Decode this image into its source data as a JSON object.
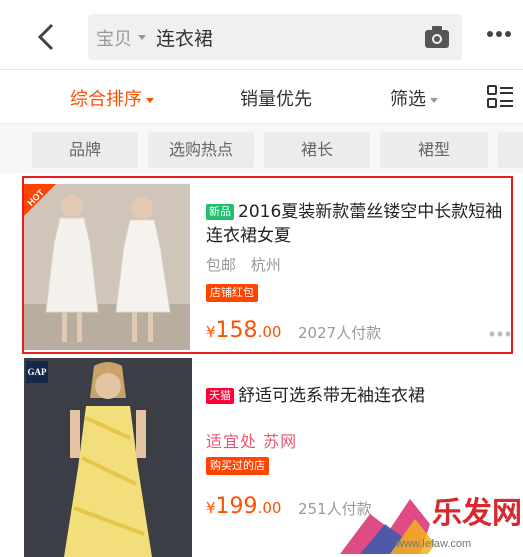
{
  "search": {
    "scope": "宝贝",
    "query": "连衣裙"
  },
  "sort": {
    "items": [
      {
        "label": "综合排序",
        "active": true
      },
      {
        "label": "销量优先",
        "active": false
      },
      {
        "label": "筛选",
        "active": false
      }
    ]
  },
  "filters": [
    "品牌",
    "选购热点",
    "裙长",
    "裙型"
  ],
  "products": [
    {
      "hot_badge": "HOT",
      "tag": "新品",
      "title": "2016夏装新款蕾丝镂空中长款短袖连衣裙女夏",
      "shipping": "包邮",
      "location": "杭州",
      "promo": "店铺红包",
      "price_symbol": "¥",
      "price_int": "158",
      "price_dec": ".00",
      "buyers": "2027人付款"
    },
    {
      "brand_logo": "GAP",
      "tag": "天猫",
      "title": "舒适可选系带无袖连衣裙",
      "shop": "适宜处 苏网",
      "promo": "购买过的店",
      "price_symbol": "¥",
      "price_int": "199",
      "price_dec": ".00",
      "buyers": "251人付款"
    }
  ],
  "watermark": {
    "text": "乐发网",
    "url": "www.lefaw.com"
  },
  "colors": {
    "accent": "#ff5000",
    "highlight_border": "#e61e1e",
    "tmall_tag": "#ff0036",
    "new_tag": "#1fbf6b"
  }
}
